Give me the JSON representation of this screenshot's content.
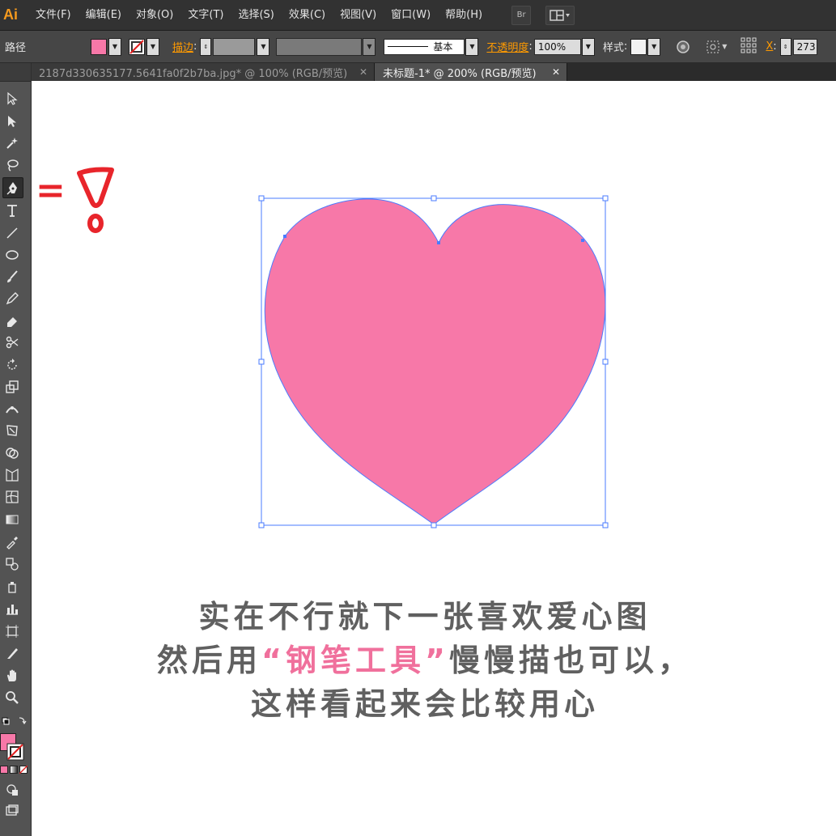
{
  "app": {
    "logo": "Ai"
  },
  "menu": {
    "items": [
      "文件(F)",
      "编辑(E)",
      "对象(O)",
      "文字(T)",
      "选择(S)",
      "效果(C)",
      "视图(V)",
      "窗口(W)",
      "帮助(H)"
    ],
    "bridge": "Br"
  },
  "control": {
    "object_type": "路径",
    "stroke_label": "描边",
    "stroke_profile": "基本",
    "opacity_label": "不透明度",
    "opacity_value": "100%",
    "style_label": "样式",
    "x_label": "X",
    "x_value": "273"
  },
  "tabs": [
    {
      "title": "2187d330635177.5641fa0f2b7ba.jpg* @ 100% (RGB/预览)",
      "close": "✕"
    },
    {
      "title": "未标题-1* @ 200% (RGB/预览)",
      "close": "✕"
    }
  ],
  "colors": {
    "fill": "#f778a8",
    "selection": "#4a7bff",
    "accent_orange": "#ff9a00",
    "annotation_red": "#e8252b",
    "caption_gray": "#606060",
    "caption_pink": "#f0709c"
  },
  "annotation": {
    "equals": "="
  },
  "caption": {
    "line1": "实在不行就下一张喜欢爱心图",
    "line2_prefix": "然后用",
    "line2_highlight": "“钢笔工具”",
    "line2_suffix": "慢慢描也可以，",
    "line3": "这样看起来会比较用心"
  }
}
